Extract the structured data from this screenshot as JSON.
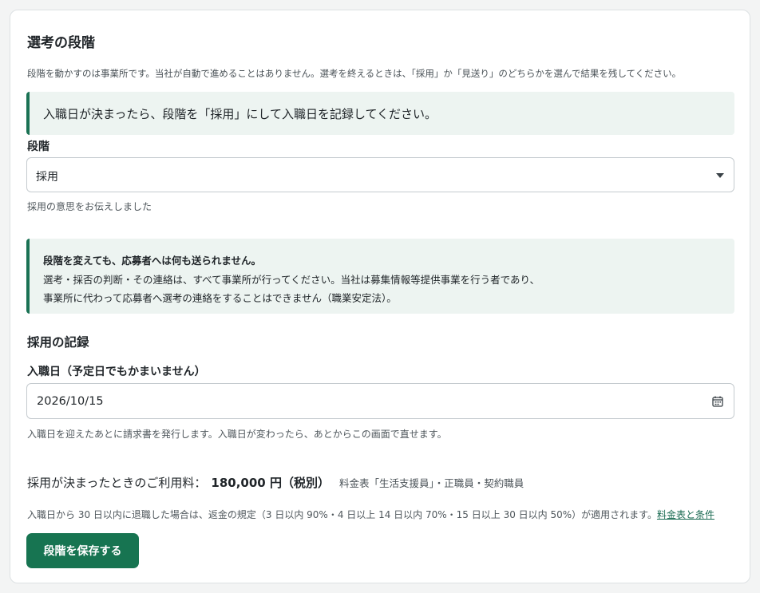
{
  "panel": {
    "title": "選考の段階",
    "description": "段階を動かすのは事業所です。当社が自動で進めることはありません。選考を終えるときは、「採用」か「見送り」のどちらかを選んで結果を残してください。"
  },
  "notice_hire": "入職日が決まったら、段階を「採用」にして入職日を記録してください。",
  "stage": {
    "label": "段階",
    "selected": "採用",
    "hint": "採用の意思をお伝えしました"
  },
  "notice_contact": {
    "title": "段階を変えても、応募者へは何も送られません。",
    "line1": "選考・採否の判断・その連絡は、すべて事業所が行ってください。当社は募集情報等提供事業を行う者であり、",
    "line2": "事業所に代わって応募者へ選考の連絡をすることはできません（職業安定法）。"
  },
  "hire_record": {
    "section_title": "採用の記録",
    "date_label": "入職日（予定日でもかまいません）",
    "date_value": "2026/10/15",
    "date_hint": "入職日を迎えたあとに請求書を発行します。入職日が変わったら、あとからこの画面で直せます。"
  },
  "fee": {
    "label": "採用が決まったときのご利用料：",
    "amount": "180,000 円（税別）",
    "note": "料金表「生活支援員」・正職員・契約職員"
  },
  "refund": {
    "text": "入職日から 30 日以内に退職した場合は、返金の規定（3 日以内 90%・4 日以上 14 日以内 70%・15 日以上 30 日以内 50%）が適用されます。",
    "link": "料金表と条件"
  },
  "save_button": "段階を保存する",
  "colors": {
    "accent": "#177451",
    "callout_bg": "#edf4f1",
    "page_bg": "#f3f4f4"
  },
  "icons": {
    "select": "chevron-down-icon",
    "date": "calendar-icon"
  }
}
